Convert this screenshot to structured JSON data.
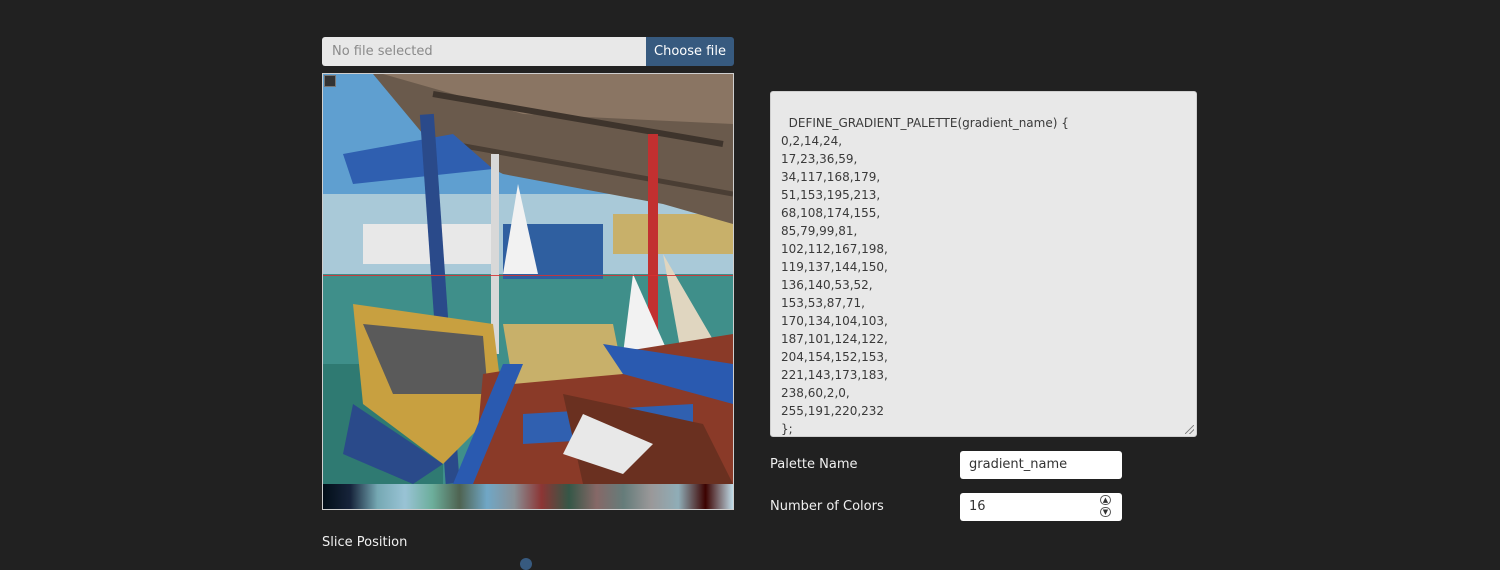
{
  "file_picker": {
    "status_text": "No file selected",
    "button_label": "Choose file"
  },
  "image_viewer": {
    "slice_line_position": 0.49
  },
  "gradient_output": {
    "code": "DEFINE_GRADIENT_PALETTE(gradient_name) {\n0,2,14,24,\n17,23,36,59,\n34,117,168,179,\n51,153,195,213,\n68,108,174,155,\n85,79,99,81,\n102,112,167,198,\n119,137,144,150,\n136,140,53,52,\n153,53,87,71,\n170,134,104,103,\n187,101,124,122,\n204,154,152,153,\n221,143,173,183,\n238,60,2,0,\n255,191,220,232\n};"
  },
  "palette_name": {
    "label": "Palette Name",
    "value": "gradient_name"
  },
  "number_of_colors": {
    "label": "Number of Colors",
    "value": "16"
  },
  "slice_position": {
    "label": "Slice Position"
  },
  "palette_stops": [
    {
      "pos": 0,
      "color": "#020e18"
    },
    {
      "pos": 17,
      "color": "#17243b"
    },
    {
      "pos": 34,
      "color": "#75a8b3"
    },
    {
      "pos": 51,
      "color": "#99c3d5"
    },
    {
      "pos": 68,
      "color": "#6cae9b"
    },
    {
      "pos": 85,
      "color": "#4f6351"
    },
    {
      "pos": 102,
      "color": "#70a7c6"
    },
    {
      "pos": 119,
      "color": "#899096"
    },
    {
      "pos": 136,
      "color": "#8c3534"
    },
    {
      "pos": 153,
      "color": "#355747"
    },
    {
      "pos": 170,
      "color": "#866867"
    },
    {
      "pos": 187,
      "color": "#657c7a"
    },
    {
      "pos": 204,
      "color": "#9a9899"
    },
    {
      "pos": 221,
      "color": "#8fadb7"
    },
    {
      "pos": 238,
      "color": "#3c0200"
    },
    {
      "pos": 255,
      "color": "#bfdce8"
    }
  ],
  "colors": {
    "accent": "#375a7f",
    "background": "#212121",
    "slice_line": "#d83030"
  }
}
